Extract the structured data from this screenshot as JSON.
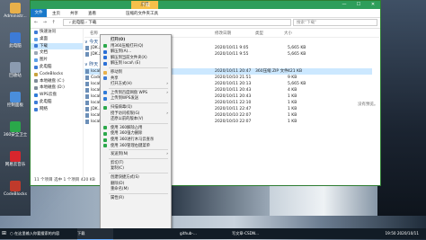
{
  "colors": {
    "accent": "#2e9e5b",
    "tool_tab": "#f6c04a",
    "taskbar": "#121c26",
    "selection": "#cce8ff"
  },
  "desktop_icons": [
    {
      "label": "Administr...",
      "color": "#e8b04a"
    },
    {
      "label": "此电脑",
      "color": "#3d7bd6"
    },
    {
      "label": "回收站",
      "color": "#8b9bb0"
    },
    {
      "label": "控制面板",
      "color": "#4a8edb"
    },
    {
      "label": "360安全卫士",
      "color": "#2aa84a"
    },
    {
      "label": "网易云音乐",
      "color": "#d8262d"
    },
    {
      "label": "CodeBlocks",
      "color": "#c03a2b"
    }
  ],
  "window": {
    "title": "下载",
    "tool_tab": "应用",
    "ctrl_min": "—",
    "ctrl_max": "☐",
    "ctrl_close": "✕",
    "ribbon": {
      "file": "文件",
      "home": "主页",
      "share": "共享",
      "view": "查看",
      "tool": "压缩的文件夹工具"
    },
    "nav_arrows": "← → ↑",
    "path": "› 此电脑 › 下载",
    "search_placeholder": "搜索\"下载\"",
    "sidebar": [
      {
        "label": "快速访问",
        "color": "#3d7bd6"
      },
      {
        "label": "桌面",
        "color": "#5aa0e8"
      },
      {
        "label": "下载",
        "color": "#3d7bd6"
      },
      {
        "label": "文档",
        "color": "#9aa7b5"
      },
      {
        "label": "图片",
        "color": "#5aa0e8"
      },
      {
        "label": "此电脑",
        "color": "#3d7bd6"
      },
      {
        "label": "CodeBlocks",
        "color": "#c8a23c"
      },
      {
        "label": "本地磁盘 (C:)",
        "color": "#7f8c99"
      },
      {
        "label": "本地磁盘 (D:)",
        "color": "#7f8c99"
      },
      {
        "label": "WPS云盘",
        "color": "#2f7bd8"
      },
      {
        "label": "此电脑",
        "color": "#3d7bd6"
      },
      {
        "label": "网络",
        "color": "#3d7bd6"
      }
    ],
    "header": {
      "name": "名称",
      "date": "修改日期",
      "type": "类型",
      "size": "大小"
    },
    "groups": [
      {
        "label": "∨ 今天 (1)"
      },
      {
        "label": "∨ 昨天 (1)"
      }
    ],
    "rows": [
      {
        "name": "JDK.zip",
        "date": "2020/10/11 9:05",
        "type": "",
        "size": "5,665 KB"
      },
      {
        "name": "JDK.zip",
        "date": "2020/10/11 9:55",
        "type": "",
        "size": "5,665 KB"
      },
      {
        "name": "local...",
        "date": "2020/10/11 20:47",
        "type": "360压缩 ZIP 文件",
        "size": "421 KB"
      },
      {
        "name": "Code...",
        "date": "2020/10/10 21:51",
        "type": "",
        "size": "9 KB"
      },
      {
        "name": "local...",
        "date": "2020/10/11 20:13",
        "type": "",
        "size": "5,665 KB"
      },
      {
        "name": "local...",
        "date": "2020/10/11 20:43",
        "type": "",
        "size": "4 KB"
      },
      {
        "name": "local...",
        "date": "2020/10/11 20:43",
        "type": "",
        "size": "1 KB"
      },
      {
        "name": "local...",
        "date": "2020/10/11 22:10",
        "type": "",
        "size": "1 KB"
      },
      {
        "name": "JDK...",
        "date": "2020/10/11 22:47",
        "type": "",
        "size": "1 KB"
      },
      {
        "name": "local...",
        "date": "2020/10/10 22:07",
        "type": "",
        "size": "1 KB"
      },
      {
        "name": "local...",
        "date": "2020/10/10 22:07",
        "type": "",
        "size": "1 KB"
      }
    ],
    "no_preview": "没有预览。",
    "status": "11 个项目   选中 1 个项目  420 KB"
  },
  "context_menu": [
    {
      "label": "打开(O)",
      "bold": true,
      "icon": "",
      "arrow": false
    },
    {
      "label": "用360压缩打开(Q)",
      "icon": "#2aa84a",
      "arrow": false
    },
    {
      "label": "解压到(A)...",
      "icon": "#2a6fd6",
      "arrow": false
    },
    {
      "label": "解压到当前文件夹(X)",
      "icon": "#2a6fd6",
      "arrow": false
    },
    {
      "label": "解压到 local\\ (E)",
      "icon": "#2a6fd6",
      "arrow": false
    },
    {
      "sep": true
    },
    {
      "label": "移动到",
      "icon": "#e8b04a",
      "arrow": false
    },
    {
      "label": "共享",
      "icon": "#3d7bd6",
      "arrow": false
    },
    {
      "label": "打开方式(H)",
      "icon": "",
      "arrow": true
    },
    {
      "sep": true
    },
    {
      "label": "上传到百度网盘 WPS",
      "icon": "#2f7bd8",
      "arrow": true
    },
    {
      "label": "上传到WPS发送",
      "icon": "#2f7bd8",
      "arrow": false
    },
    {
      "sep": true
    },
    {
      "label": "扫描病毒(Q)",
      "icon": "#2aa84a",
      "arrow": false
    },
    {
      "label": "授予访问权限(G)",
      "icon": "",
      "arrow": true
    },
    {
      "label": "还原以前的版本(V)",
      "icon": "",
      "arrow": false
    },
    {
      "sep": true
    },
    {
      "label": "使用 360解除占用",
      "icon": "#2aa84a",
      "arrow": false
    },
    {
      "label": "使用 360强力删除",
      "icon": "#2aa84a",
      "arrow": false
    },
    {
      "label": "使用 360进行木马云查杀",
      "icon": "#2aa84a",
      "arrow": false
    },
    {
      "label": "使用 360管理右键菜单",
      "icon": "#2aa84a",
      "arrow": false
    },
    {
      "sep": true
    },
    {
      "label": "发送到(N)",
      "icon": "",
      "arrow": true
    },
    {
      "sep": true
    },
    {
      "label": "剪切(T)",
      "icon": "",
      "arrow": false
    },
    {
      "label": "复制(C)",
      "icon": "",
      "arrow": false
    },
    {
      "sep": true
    },
    {
      "label": "创建快捷方式(S)",
      "icon": "",
      "arrow": false
    },
    {
      "label": "删除(D)",
      "icon": "",
      "arrow": false
    },
    {
      "label": "重命名(M)",
      "icon": "",
      "arrow": false
    },
    {
      "sep": true
    },
    {
      "label": "属性(R)",
      "icon": "",
      "arrow": false
    }
  ],
  "taskbar": {
    "start": "⊞",
    "items": [
      {
        "label": "○ 在这里输入你要搜索的内容",
        "active": false
      },
      {
        "label": "下载",
        "active": true
      },
      {
        "label": "github-...",
        "active": false
      },
      {
        "label": "写文章-CSDN...",
        "active": false
      }
    ],
    "clock": "19:50  2020/10/11"
  }
}
